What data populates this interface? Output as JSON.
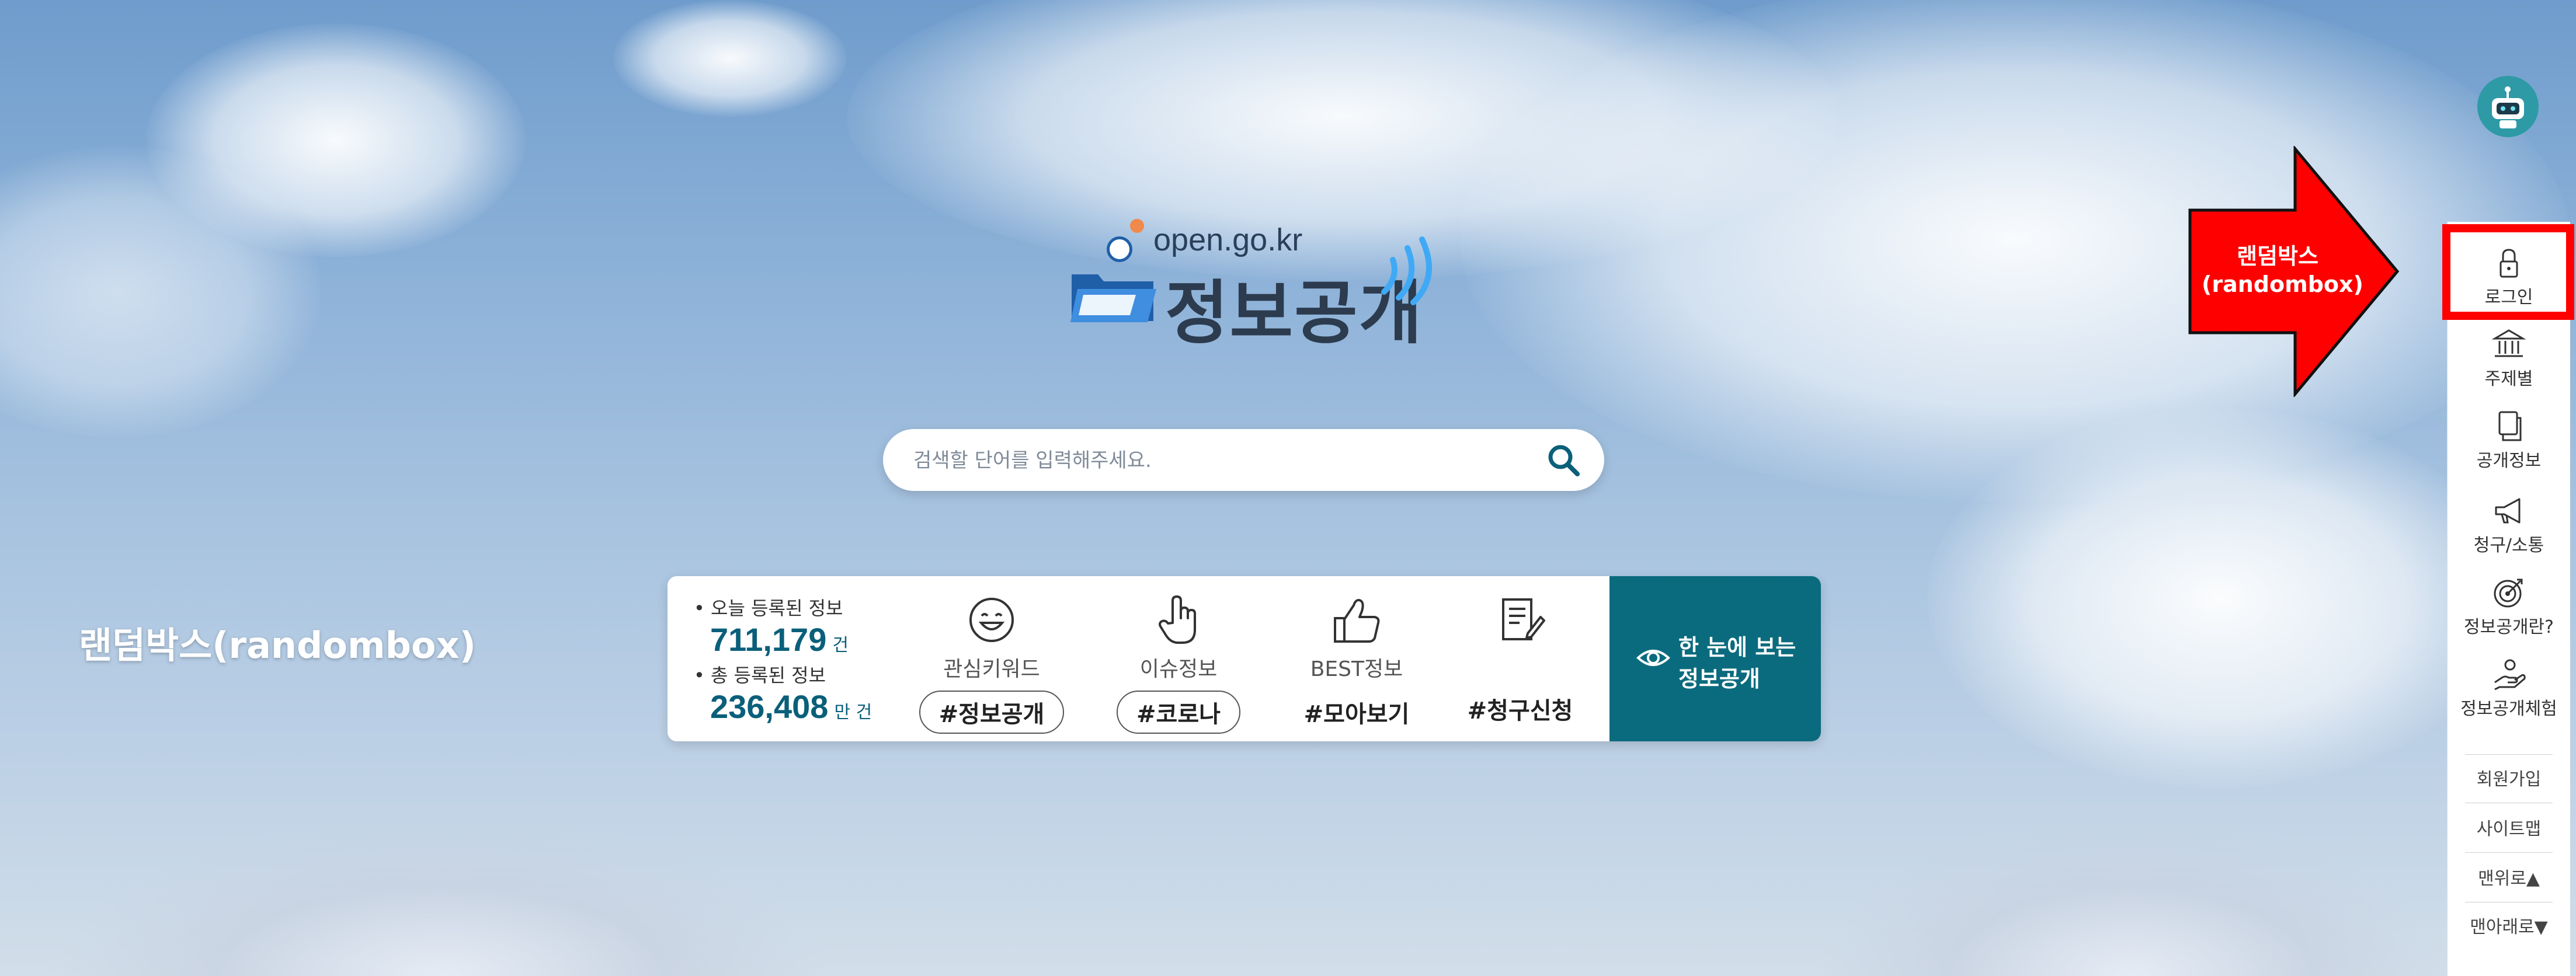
{
  "logo": {
    "domain": "open.go.kr",
    "title": "정보공개"
  },
  "search": {
    "placeholder": "검색할 단어를 입력해주세요."
  },
  "stats": {
    "today_label": "오늘 등록된 정보",
    "today_value": "711,179",
    "today_unit": "건",
    "total_label": "총 등록된 정보",
    "total_value": "236,408",
    "total_unit": "만 건"
  },
  "categories": [
    {
      "label": "관심키워드",
      "link": "#정보공개",
      "icon": "smiley-icon"
    },
    {
      "label": "이슈정보",
      "link": "#코로나",
      "icon": "pointer-hand-icon"
    },
    {
      "label": "BEST정보",
      "link": "#모아보기",
      "icon": "thumbs-up-icon"
    },
    {
      "label": "",
      "link": "#청구신청",
      "icon": "document-edit-icon"
    }
  ],
  "cta": {
    "line1": "한 눈에 보는",
    "line2": "정보공개"
  },
  "left_label": "랜덤박스(randombox)",
  "annotation": {
    "line1": "랜덤박스",
    "line2": "(randombox)"
  },
  "sidebar": {
    "items": [
      {
        "label": "로그인",
        "icon": "lock-icon"
      },
      {
        "label": "주제별",
        "icon": "building-icon"
      },
      {
        "label": "공개정보",
        "icon": "copy-icon"
      },
      {
        "label": "청구/소통",
        "icon": "megaphone-icon"
      },
      {
        "label": "정보공개란?",
        "icon": "target-icon"
      },
      {
        "label": "정보공개체험",
        "icon": "hand-icon"
      }
    ],
    "links": [
      "회원가입",
      "사이트맵",
      "맨위로▲",
      "맨아래로▼"
    ]
  },
  "colors": {
    "accent": "#0b6b7e",
    "annotation": "#ff0000"
  }
}
